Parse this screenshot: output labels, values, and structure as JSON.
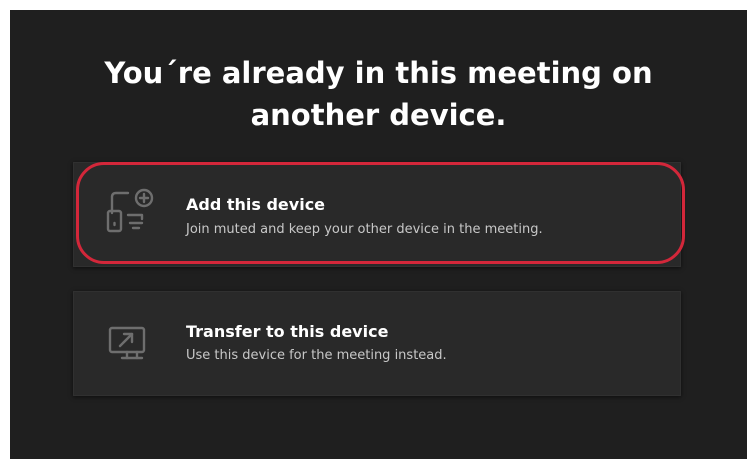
{
  "dialog": {
    "title_line1": "You´re already in this meeting on",
    "title_line2": "another device."
  },
  "options": [
    {
      "title": "Add this device",
      "description": "Join muted and keep your other device in the meeting.",
      "icon": "add-device-icon",
      "highlighted": true
    },
    {
      "title": "Transfer to this device",
      "description": "Use this device for the meeting instead.",
      "icon": "transfer-screen-icon",
      "highlighted": false
    }
  ],
  "colors": {
    "background": "#1f1f1f",
    "card": "#292929",
    "highlight": "#d3273a",
    "icon": "#6e6e6e",
    "text": "#ffffff",
    "subtext": "#c8c8c8"
  }
}
